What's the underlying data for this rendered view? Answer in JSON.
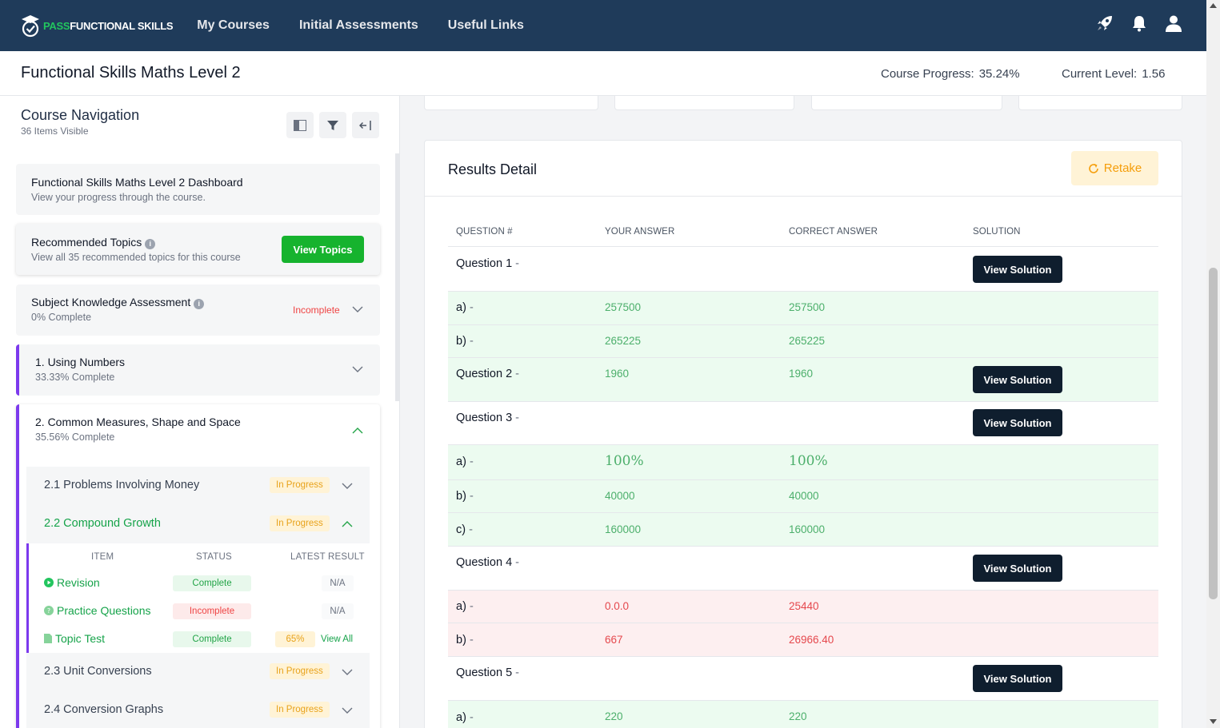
{
  "brand": {
    "pass": "PASS",
    "rest": "FUNCTIONAL SKILLS"
  },
  "nav": {
    "links": [
      "My Courses",
      "Initial Assessments",
      "Useful Links"
    ]
  },
  "header": {
    "title": "Functional Skills Maths Level 2",
    "progress_label": "Course Progress:",
    "progress_value": "35.24%",
    "level_label": "Current Level:",
    "level_value": "1.56"
  },
  "sidebar": {
    "title": "Course Navigation",
    "subtitle": "36 Items Visible",
    "dashboard": {
      "title": "Functional Skills Maths Level 2 Dashboard",
      "sub": "View your progress through the course."
    },
    "recommended": {
      "title": "Recommended Topics",
      "sub": "View all 35 recommended topics for this course",
      "button": "View Topics"
    },
    "ska": {
      "title": "Subject Knowledge Assessment",
      "sub": "0% Complete",
      "status": "Incomplete"
    },
    "sections": [
      {
        "title": "1. Using Numbers",
        "progress": "33.33% Complete"
      },
      {
        "title": "2. Common Measures, Shape and Space",
        "progress": "35.56% Complete"
      }
    ],
    "subtopics": [
      {
        "title": "2.1 Problems Involving Money",
        "status": "In Progress"
      },
      {
        "title": "2.2 Compound Growth",
        "status": "In Progress"
      },
      {
        "title": "2.3 Unit Conversions",
        "status": "In Progress"
      },
      {
        "title": "2.4 Conversion Graphs",
        "status": "In Progress"
      }
    ],
    "table": {
      "headers": [
        "ITEM",
        "STATUS",
        "LATEST RESULT"
      ],
      "rows": [
        {
          "item": "Revision",
          "status": "Complete",
          "result": "N/A"
        },
        {
          "item": "Practice Questions",
          "status": "Incomplete",
          "result": "N/A"
        },
        {
          "item": "Topic Test",
          "status": "Complete",
          "result": "65%",
          "link": "View All"
        }
      ]
    }
  },
  "results": {
    "title": "Results Detail",
    "retake": "Retake",
    "headers": [
      "QUESTION #",
      "YOUR ANSWER",
      "CORRECT ANSWER",
      "SOLUTION"
    ],
    "view_solution": "View Solution",
    "rows": [
      {
        "label": "Question 1",
        "your": "",
        "correct": ""
      },
      {
        "label": "a)",
        "your": "257500",
        "correct": "257500"
      },
      {
        "label": "b)",
        "your": "265225",
        "correct": "265225"
      },
      {
        "label": "Question 2",
        "your": "1960",
        "correct": "1960"
      },
      {
        "label": "Question 3",
        "your": "",
        "correct": ""
      },
      {
        "label": "a)",
        "your": "100%",
        "correct": "100%"
      },
      {
        "label": "b)",
        "your": "40000",
        "correct": "40000"
      },
      {
        "label": "c)",
        "your": "160000",
        "correct": "160000"
      },
      {
        "label": "Question 4",
        "your": "",
        "correct": ""
      },
      {
        "label": "a)",
        "your": "0.0.0",
        "correct": "25440"
      },
      {
        "label": "b)",
        "your": "667",
        "correct": "26966.40"
      },
      {
        "label": "Question 5",
        "your": "",
        "correct": ""
      },
      {
        "label": "a)",
        "your": "220",
        "correct": "220"
      }
    ],
    "dash": "-"
  },
  "colors": {
    "nav_bg": "#1f3b5a",
    "green": "#16b32e",
    "purple": "#7c3aed",
    "retake": "#f59e0b"
  }
}
